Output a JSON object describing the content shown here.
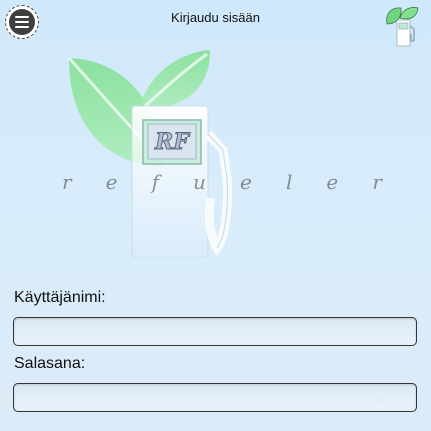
{
  "header": {
    "title": "Kirjaudu sisään",
    "menu_icon": "hamburger-menu-icon",
    "brand_icon": "fuel-pump-leaf-icon"
  },
  "logo": {
    "badge_text": "RF",
    "wordmark_letters": [
      "r",
      "e",
      "f",
      "u",
      "e",
      "l",
      "e",
      "r"
    ]
  },
  "form": {
    "username_label": "Käyttäjänimi:",
    "username_value": "",
    "password_label": "Salasana:",
    "password_value": ""
  },
  "colors": {
    "leaf_green": "#7fe08f",
    "background": "#d6eafb",
    "pump_white": "#f4fbfd"
  }
}
